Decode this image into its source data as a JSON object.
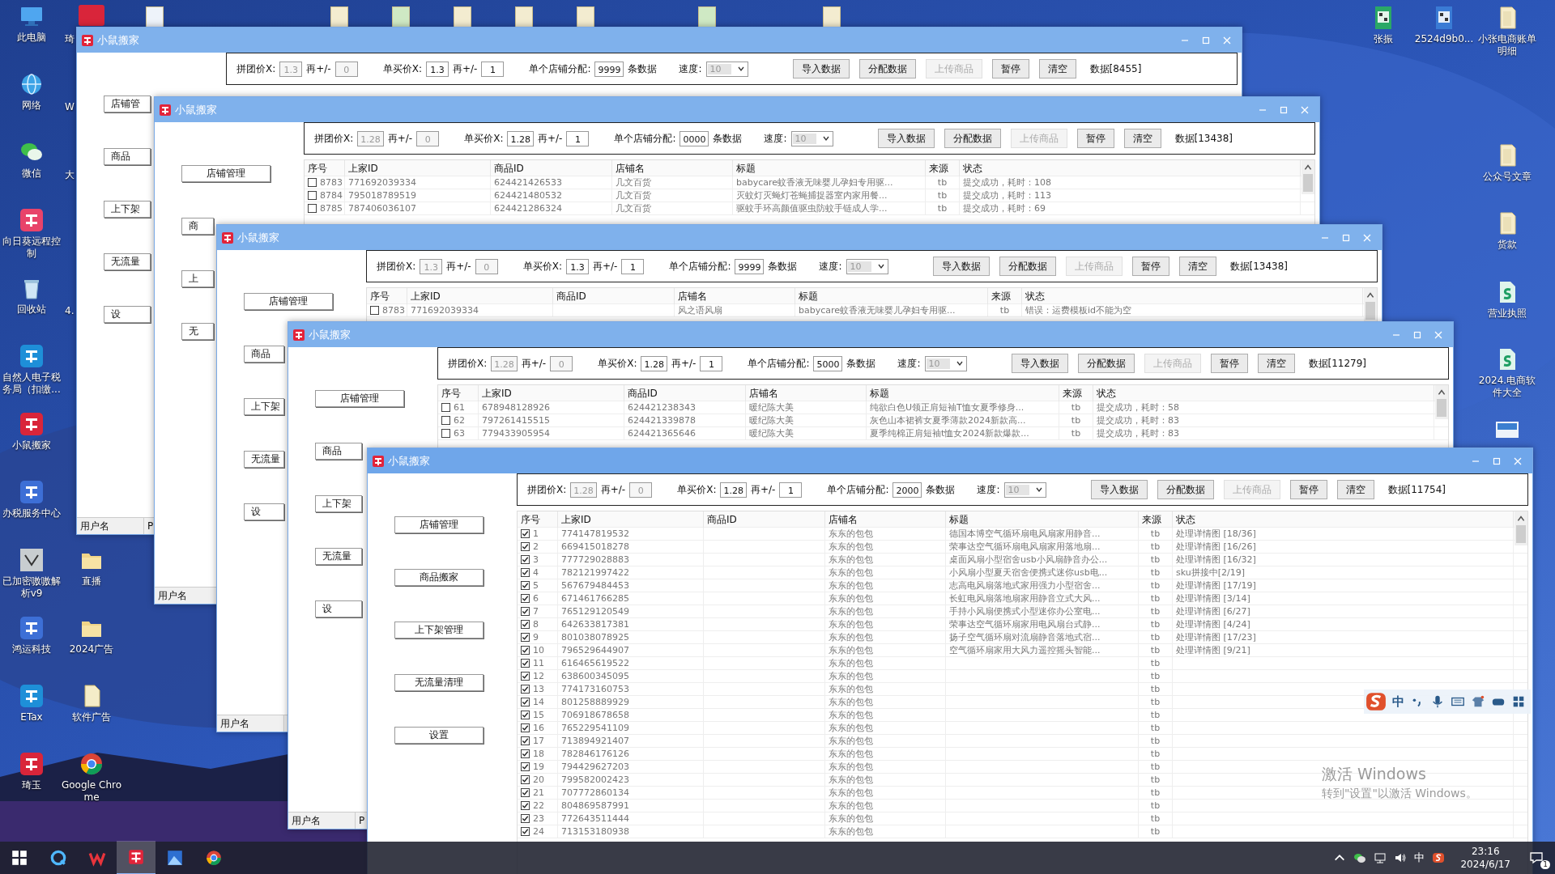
{
  "desktop": {
    "left_column": [
      {
        "label": "此电脑"
      },
      {
        "label": "网络"
      },
      {
        "label": "微信"
      },
      {
        "label": "向日葵远程控制"
      },
      {
        "label": "回收站"
      },
      {
        "label": "自然人电子税务局（扣缴..."
      },
      {
        "label": "小鼠搬家"
      },
      {
        "label": "办税服务中心"
      },
      {
        "label": "已加密嗷嗷解析v9"
      },
      {
        "label": "鸿运科技"
      },
      {
        "label": "ETax"
      },
      {
        "label": "琦玉"
      }
    ],
    "second_column_cut": [
      {
        "label": "琦"
      },
      {
        "label": "W"
      },
      {
        "label": "大"
      },
      {
        "label": "4."
      }
    ],
    "second_column": [
      {
        "label": "直播"
      },
      {
        "label": "2024广告"
      },
      {
        "label": "软件广告"
      },
      {
        "label": "Google Chrome"
      }
    ],
    "right_icons": [
      {
        "label": "张振"
      },
      {
        "label": "2524d9b0..."
      },
      {
        "label": "小张电商账单明细"
      },
      {
        "label": "公众号文章"
      },
      {
        "label": "货款"
      },
      {
        "label": "营业执照"
      },
      {
        "label": "2024.电商软件大全"
      }
    ]
  },
  "windows": [
    {
      "title": "小鼠搬家",
      "sidebar": [
        "店铺管",
        "商品",
        "上下架",
        "无流量",
        "设"
      ],
      "toolbar": {
        "fields": [
          {
            "label": "拼团价X:",
            "value": "1.3",
            "disabled": true
          },
          {
            "label": "再+/-",
            "value": "0",
            "disabled": true
          },
          {
            "label": "单买价X:",
            "value": "1.3",
            "disabled": false
          },
          {
            "label": "再+/-",
            "value": "1",
            "disabled": false
          },
          {
            "label": "单个店铺分配:",
            "value": "9999",
            "disabled": false,
            "suffix": "条数据"
          }
        ],
        "speed": {
          "label": "速度:",
          "value": "10"
        },
        "buttons": [
          {
            "label": "导入数据",
            "disabled": false
          },
          {
            "label": "分配数据",
            "disabled": false
          },
          {
            "label": "上传商品",
            "disabled": true
          },
          {
            "label": "暂停",
            "disabled": false
          },
          {
            "label": "清空",
            "disabled": false
          }
        ],
        "count": "数据[8455]"
      },
      "status_bar": [
        "用户名",
        "P"
      ]
    },
    {
      "title": "小鼠搬家",
      "sidebar": [
        "店铺管理",
        "商",
        "上",
        "无"
      ],
      "toolbar": {
        "fields": [
          {
            "label": "拼团价X:",
            "value": "1.28",
            "disabled": true
          },
          {
            "label": "再+/-",
            "value": "0",
            "disabled": true
          },
          {
            "label": "单买价X:",
            "value": "1.28",
            "disabled": false
          },
          {
            "label": "再+/-",
            "value": "1",
            "disabled": false
          },
          {
            "label": "单个店铺分配:",
            "value": "0000",
            "disabled": false,
            "suffix": "条数据"
          }
        ],
        "speed": {
          "label": "速度:",
          "value": "10"
        },
        "buttons": [
          {
            "label": "导入数据",
            "disabled": false
          },
          {
            "label": "分配数据",
            "disabled": false
          },
          {
            "label": "上传商品",
            "disabled": true
          },
          {
            "label": "暂停",
            "disabled": false
          },
          {
            "label": "清空",
            "disabled": false
          }
        ],
        "count": "数据[13438]"
      },
      "table": {
        "columns": [
          "序号",
          "上家ID",
          "商品ID",
          "店铺名",
          "标题",
          "来源",
          "状态"
        ],
        "rows": [
          {
            "checked": false,
            "no": "8783",
            "seller_id": "771692039334",
            "item_id": "624421426533",
            "shop": "几文百货",
            "title": "babycare蚊香液无味婴儿孕妇专用驱...",
            "source": "tb",
            "status": "提交成功，耗时：108"
          },
          {
            "checked": false,
            "no": "8784",
            "seller_id": "795018789519",
            "item_id": "624421480532",
            "shop": "几文百货",
            "title": "灭蚊灯灭蝇灯苍蝇捕捉器室内家用餐...",
            "source": "tb",
            "status": "提交成功，耗时：113"
          },
          {
            "checked": false,
            "no": "8785",
            "seller_id": "787406036107",
            "item_id": "624421286324",
            "shop": "几文百货",
            "title": "驱蚊手环高颜值驱虫防蚊手链成人学...",
            "source": "tb",
            "status": "提交成功，耗时：69"
          }
        ]
      },
      "status_bar": [
        "用户名"
      ]
    },
    {
      "title": "小鼠搬家",
      "sidebar": [
        "店铺管理",
        "商品",
        "上下架",
        "无流量",
        "设"
      ],
      "toolbar": {
        "fields": [
          {
            "label": "拼团价X:",
            "value": "1.3",
            "disabled": true
          },
          {
            "label": "再+/-",
            "value": "0",
            "disabled": true
          },
          {
            "label": "单买价X:",
            "value": "1.3",
            "disabled": false
          },
          {
            "label": "再+/-",
            "value": "1",
            "disabled": false
          },
          {
            "label": "单个店铺分配:",
            "value": "9999",
            "disabled": false,
            "suffix": "条数据"
          }
        ],
        "speed": {
          "label": "速度:",
          "value": "10"
        },
        "buttons": [
          {
            "label": "导入数据",
            "disabled": false
          },
          {
            "label": "分配数据",
            "disabled": false
          },
          {
            "label": "上传商品",
            "disabled": true
          },
          {
            "label": "暂停",
            "disabled": false
          },
          {
            "label": "清空",
            "disabled": false
          }
        ],
        "count": "数据[13438]"
      },
      "table": {
        "columns": [
          "序号",
          "上家ID",
          "商品ID",
          "店铺名",
          "标题",
          "来源",
          "状态"
        ],
        "rows": [
          {
            "checked": false,
            "no": "8783",
            "seller_id": "771692039334",
            "shop": "风之语风扇",
            "title": "babycare蚊香液无味婴儿孕妇专用驱...",
            "source": "tb",
            "status": "错误：运费模板id不能为空"
          }
        ]
      },
      "status_bar": [
        "用户名"
      ]
    },
    {
      "title": "小鼠搬家",
      "sidebar": [
        "店铺管理",
        "商品",
        "上下架",
        "无流量",
        "设"
      ],
      "toolbar": {
        "fields": [
          {
            "label": "拼团价X:",
            "value": "1.28",
            "disabled": true
          },
          {
            "label": "再+/-",
            "value": "0",
            "disabled": true
          },
          {
            "label": "单买价X:",
            "value": "1.28",
            "disabled": false
          },
          {
            "label": "再+/-",
            "value": "1",
            "disabled": false
          },
          {
            "label": "单个店铺分配:",
            "value": "5000",
            "disabled": false,
            "suffix": "条数据"
          }
        ],
        "speed": {
          "label": "速度:",
          "value": "10"
        },
        "buttons": [
          {
            "label": "导入数据",
            "disabled": false
          },
          {
            "label": "分配数据",
            "disabled": false
          },
          {
            "label": "上传商品",
            "disabled": true
          },
          {
            "label": "暂停",
            "disabled": false
          },
          {
            "label": "清空",
            "disabled": false
          }
        ],
        "count": "数据[11279]"
      },
      "table": {
        "columns": [
          "序号",
          "上家ID",
          "商品ID",
          "店铺名",
          "标题",
          "来源",
          "状态"
        ],
        "rows": [
          {
            "checked": false,
            "no": "61",
            "seller_id": "678948128926",
            "item_id": "624421238343",
            "shop": "暖纪陈大美",
            "title": "纯欲白色U领正肩短袖T恤女夏季修身...",
            "source": "tb",
            "status": "提交成功，耗时：58"
          },
          {
            "checked": false,
            "no": "62",
            "seller_id": "797261415515",
            "item_id": "624421339878",
            "shop": "暖纪陈大美",
            "title": "灰色山本裙裤女夏季薄款2024新款高...",
            "source": "tb",
            "status": "提交成功，耗时：83"
          },
          {
            "checked": false,
            "no": "63",
            "seller_id": "779433905954",
            "item_id": "624421365646",
            "shop": "暖纪陈大美",
            "title": "夏季纯棉正肩短袖t恤女2024新款爆款...",
            "source": "tb",
            "status": "提交成功，耗时：83"
          }
        ]
      },
      "status_bar": [
        "用户名",
        "P"
      ]
    },
    {
      "title": "小鼠搬家",
      "sidebar": [
        "店铺管理",
        "商品搬家",
        "上下架管理",
        "无流量清理",
        "设置"
      ],
      "toolbar": {
        "fields": [
          {
            "label": "拼团价X:",
            "value": "1.28",
            "disabled": true
          },
          {
            "label": "再+/-",
            "value": "0",
            "disabled": true
          },
          {
            "label": "单买价X:",
            "value": "1.28",
            "disabled": false
          },
          {
            "label": "再+/-",
            "value": "1",
            "disabled": false
          },
          {
            "label": "单个店铺分配:",
            "value": "2000",
            "disabled": false,
            "suffix": "条数据"
          }
        ],
        "speed": {
          "label": "速度:",
          "value": "10"
        },
        "buttons": [
          {
            "label": "导入数据",
            "disabled": false
          },
          {
            "label": "分配数据",
            "disabled": false
          },
          {
            "label": "上传商品",
            "disabled": true
          },
          {
            "label": "暂停",
            "disabled": false
          },
          {
            "label": "清空",
            "disabled": false
          }
        ],
        "count": "数据[11754]"
      },
      "table": {
        "columns": [
          "序号",
          "上家ID",
          "商品ID",
          "店铺名",
          "标题",
          "来源",
          "状态"
        ],
        "rows": [
          {
            "checked": true,
            "no": "1",
            "seller_id": "774147819532",
            "shop": "东东的包包",
            "title": "德国本博空气循环扇电风扇家用静音...",
            "source": "tb",
            "status": "处理详情图 [18/36]"
          },
          {
            "checked": true,
            "no": "2",
            "seller_id": "669415018278",
            "shop": "东东的包包",
            "title": "荣事达空气循环扇电风扇家用落地扇...",
            "source": "tb",
            "status": "处理详情图 [16/26]"
          },
          {
            "checked": true,
            "no": "3",
            "seller_id": "777729028883",
            "shop": "东东的包包",
            "title": "桌面风扇小型宿舍usb小风扇静音办公...",
            "source": "tb",
            "status": "处理详情图 [16/32]"
          },
          {
            "checked": true,
            "no": "4",
            "seller_id": "782121997422",
            "shop": "东东的包包",
            "title": "小风扇小型夏天宿舍便携式迷你usb电...",
            "source": "tb",
            "status": "sku拼接中[2/19]"
          },
          {
            "checked": true,
            "no": "5",
            "seller_id": "567679484453",
            "shop": "东东的包包",
            "title": "志高电风扇落地式家用强力小型宿舍...",
            "source": "tb",
            "status": "处理详情图 [17/19]"
          },
          {
            "checked": true,
            "no": "6",
            "seller_id": "671461766285",
            "shop": "东东的包包",
            "title": "长虹电风扇落地扇家用静音立式大风...",
            "source": "tb",
            "status": "处理详情图 [3/14]"
          },
          {
            "checked": true,
            "no": "7",
            "seller_id": "765129120549",
            "shop": "东东的包包",
            "title": "手持小风扇便携式小型迷你办公室电...",
            "source": "tb",
            "status": "处理详情图 [6/27]"
          },
          {
            "checked": true,
            "no": "8",
            "seller_id": "642633817381",
            "shop": "东东的包包",
            "title": "荣事达空气循环扇家用电风扇台式静...",
            "source": "tb",
            "status": "处理详情图 [4/24]"
          },
          {
            "checked": true,
            "no": "9",
            "seller_id": "801038078925",
            "shop": "东东的包包",
            "title": "扬子空气循环扇对流扇静音落地式宿...",
            "source": "tb",
            "status": "处理详情图 [17/23]"
          },
          {
            "checked": true,
            "no": "10",
            "seller_id": "796529644907",
            "shop": "东东的包包",
            "title": "空气循环扇家用大风力遥控摇头智能...",
            "source": "tb",
            "status": "处理详情图 [9/21]"
          },
          {
            "checked": true,
            "no": "11",
            "seller_id": "616465619522",
            "shop": "东东的包包",
            "source": "tb"
          },
          {
            "checked": true,
            "no": "12",
            "seller_id": "638600345095",
            "shop": "东东的包包",
            "source": "tb"
          },
          {
            "checked": true,
            "no": "13",
            "seller_id": "774173160753",
            "shop": "东东的包包",
            "source": "tb"
          },
          {
            "checked": true,
            "no": "14",
            "seller_id": "801258889929",
            "shop": "东东的包包",
            "source": "tb"
          },
          {
            "checked": true,
            "no": "15",
            "seller_id": "706918678658",
            "shop": "东东的包包",
            "source": "tb"
          },
          {
            "checked": true,
            "no": "16",
            "seller_id": "765229541109",
            "shop": "东东的包包",
            "source": "tb"
          },
          {
            "checked": true,
            "no": "17",
            "seller_id": "713894921407",
            "shop": "东东的包包",
            "source": "tb"
          },
          {
            "checked": true,
            "no": "18",
            "seller_id": "782846176126",
            "shop": "东东的包包",
            "source": "tb"
          },
          {
            "checked": true,
            "no": "19",
            "seller_id": "794429627203",
            "shop": "东东的包包",
            "source": "tb"
          },
          {
            "checked": true,
            "no": "20",
            "seller_id": "799582002423",
            "shop": "东东的包包",
            "source": "tb"
          },
          {
            "checked": true,
            "no": "21",
            "seller_id": "707772860134",
            "shop": "东东的包包",
            "source": "tb"
          },
          {
            "checked": true,
            "no": "22",
            "seller_id": "804869587991",
            "shop": "东东的包包",
            "source": "tb"
          },
          {
            "checked": true,
            "no": "23",
            "seller_id": "772643511444",
            "shop": "东东的包包",
            "source": "tb"
          },
          {
            "checked": true,
            "no": "24",
            "seller_id": "713153180938",
            "shop": "东东的包包",
            "source": "tb"
          }
        ]
      }
    }
  ],
  "ime_bar": {
    "mode": "中"
  },
  "activation_notice": {
    "title": "激活 Windows",
    "hint": "转到\"设置\"以激活 Windows。"
  },
  "taskbar": {
    "input_mode": "中",
    "time": "23:16",
    "date": "2024/6/17",
    "notification_count": "1"
  }
}
